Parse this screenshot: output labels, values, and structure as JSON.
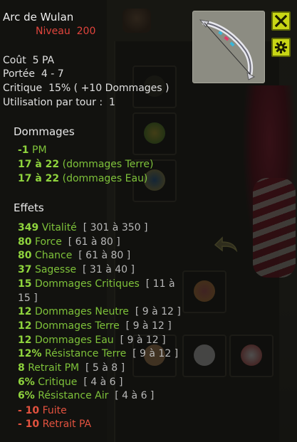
{
  "item": {
    "name": "Arc de Wulan",
    "level_label": "Niveau",
    "level": "200"
  },
  "stats": {
    "cost_label": "Coût",
    "cost": "5 PA",
    "range_label": "Portée",
    "range": "4 - 7",
    "crit_label": "Critique",
    "crit": "15% ( +10 Dommages )",
    "uses_label": "Utilisation par tour :",
    "uses": "1"
  },
  "damage": {
    "title": "Dommages",
    "lines": [
      {
        "value": "-1",
        "text": "PM"
      },
      {
        "value": "17 à 22",
        "text": "(dommages Terre)"
      },
      {
        "value": "17 à 22",
        "text": "(dommages Eau)"
      }
    ]
  },
  "effects": {
    "title": "Effets",
    "lines": [
      {
        "value": "349",
        "text": "Vitalité",
        "range": "[ 301 à 350 ]"
      },
      {
        "value": "80",
        "text": "Force",
        "range": "[ 61 à 80 ]"
      },
      {
        "value": "80",
        "text": "Chance",
        "range": "[ 61 à 80 ]"
      },
      {
        "value": "37",
        "text": "Sagesse",
        "range": "[ 31 à 40 ]"
      },
      {
        "value": "15",
        "text": "Dommages Critiques",
        "range": "[ 11 à",
        "range2": "15 ]"
      },
      {
        "value": "12",
        "text": "Dommages Neutre",
        "range": "[ 9 à 12 ]"
      },
      {
        "value": "12",
        "text": "Dommages Terre",
        "range": "[ 9 à 12 ]"
      },
      {
        "value": "12",
        "text": "Dommages Eau",
        "range": "[ 9 à 12 ]"
      },
      {
        "value": "12%",
        "text": "Résistance Terre",
        "range": "[ 9 à 12 ]"
      },
      {
        "value": "8",
        "text": "Retrait PM",
        "range": "[ 5 à 8 ]"
      },
      {
        "value": "6%",
        "text": "Critique",
        "range": "[ 4 à 6 ]"
      },
      {
        "value": "6%",
        "text": "Résistance Air",
        "range": "[ 4 à 6 ]"
      }
    ],
    "negatives": [
      {
        "value": "- 10",
        "text": "Fuite"
      },
      {
        "value": "- 10",
        "text": "Retrait PA"
      }
    ]
  },
  "icons": {
    "close": "close-icon",
    "settings": "gear-icon",
    "item": "bow-icon"
  },
  "colors": {
    "accent": "#c8d615",
    "positive": "#7ec23a",
    "negative": "#e3523f",
    "level": "#e0443c"
  }
}
